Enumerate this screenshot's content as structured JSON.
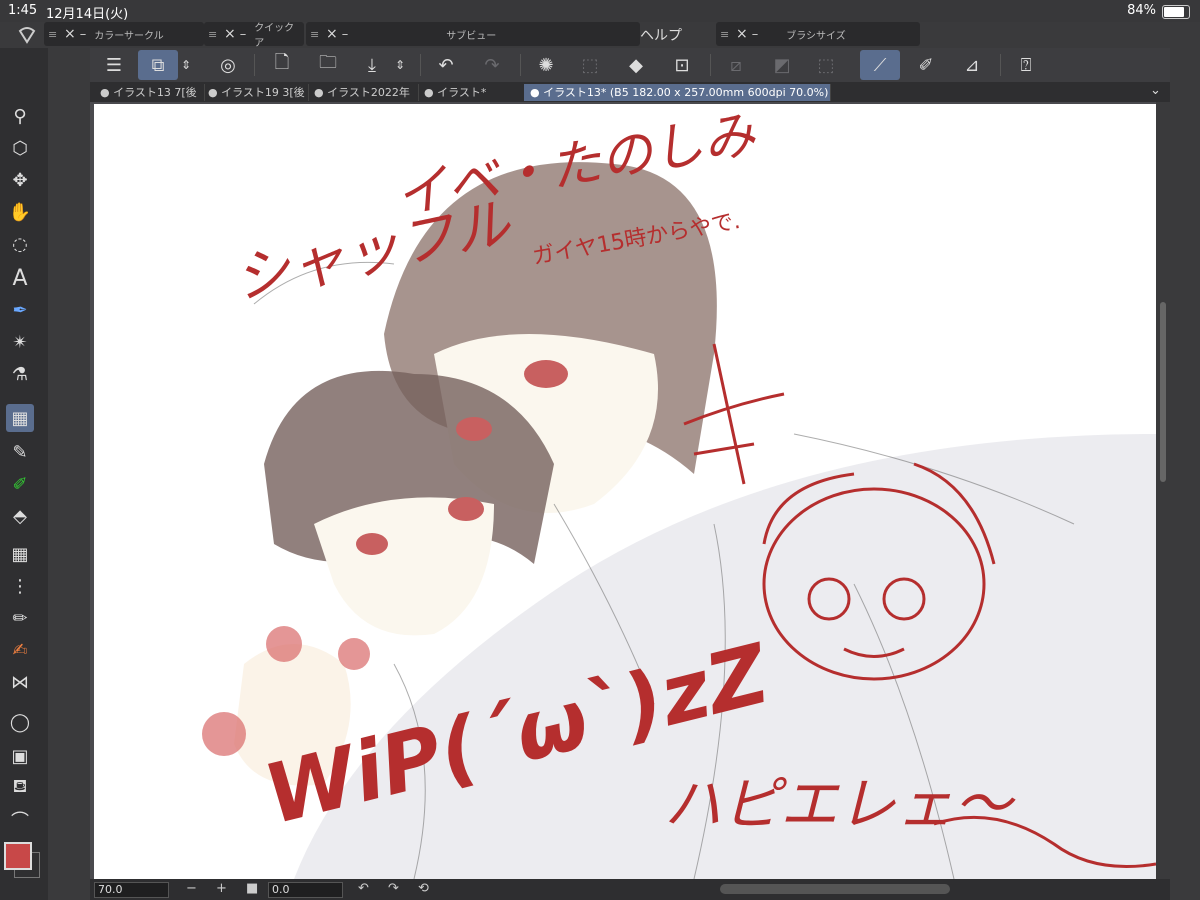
{
  "status": {
    "time": "1:45",
    "date": "12月14日(火)",
    "battery": "84%"
  },
  "palettes": [
    {
      "title": "カラーサークル"
    },
    {
      "title": "クイックア"
    },
    {
      "title": "サブビュー"
    },
    {
      "title": "ブラシサイズ"
    }
  ],
  "menu": {
    "help": "ヘルプ"
  },
  "tabs": [
    {
      "label": "● イラスト13 7[後"
    },
    {
      "label": "● イラスト19 3[後"
    },
    {
      "label": "● イラスト2022年"
    },
    {
      "label": "● イラスト*"
    },
    {
      "label": "● イラスト13* (B5 182.00 x 257.00mm 600dpi 70.0%)"
    }
  ],
  "artwork": {
    "line1": "シャッフル",
    "line2": "イベ・たのしみ",
    "line3": "ガイヤ15時からやで.",
    "line4": "WiP(´ω`)zZ",
    "line5": "ハピエレェ〜"
  },
  "bottombar": {
    "zoom": "70.0",
    "angle": "0.0"
  },
  "colors": {
    "accent": "#5a6d8e",
    "ink": "#b52e2e",
    "main_color": "#c84848"
  },
  "icons": [
    "menu-icon",
    "layer-icon",
    "new-file-icon",
    "open-folder-icon",
    "save-icon",
    "undo-icon",
    "redo-icon",
    "loading-icon",
    "select-icon",
    "fill-icon",
    "transform-icon",
    "help-icon",
    "zoom-icon",
    "move-icon",
    "hand-icon",
    "lasso-icon",
    "text-icon",
    "pen-icon",
    "magic-wand-icon",
    "eyedropper-icon",
    "eraser-icon",
    "bucket-icon"
  ]
}
